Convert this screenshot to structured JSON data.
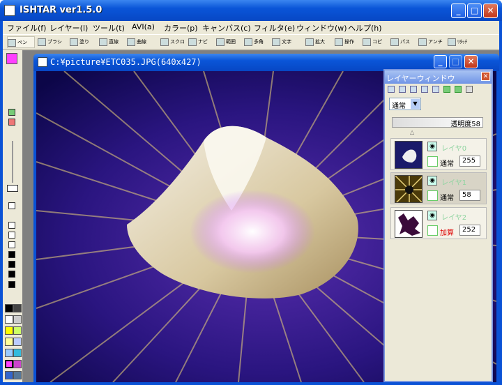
{
  "window": {
    "title": "ISHTAR ver1.5.0"
  },
  "menu": [
    "ファイル(f)",
    "レイヤー(l)",
    "ツール(t)",
    "AVI(a)",
    "カラー(p)",
    "キャンバス(c)",
    "フィルタ(e)",
    "ウィンドウ(w)",
    "ヘルプ(h)"
  ],
  "toolbar": [
    "ペン",
    "ブラシ",
    "塗り",
    "直線",
    "曲線",
    "スクロ",
    "ナビ",
    "範囲",
    "多角",
    "文字",
    "拡大",
    "操作",
    "コピ",
    "パス",
    "アンチ",
    "ﾘﾀｯﾁ"
  ],
  "document": {
    "title": "C:¥picture¥ETC035.JPG(640x427)"
  },
  "layer_window": {
    "title": "レイヤーウィンドウ",
    "blend_mode": "通常",
    "opacity_label": "透明度58",
    "layers": [
      {
        "name": "レイヤ0",
        "mode": "通常",
        "opacity": "255"
      },
      {
        "name": "レイヤ1",
        "mode": "通常",
        "opacity": "58"
      },
      {
        "name": "レイヤ2",
        "mode": "加算",
        "opacity": "252"
      }
    ]
  },
  "colors": {
    "primary": "#ff40ff",
    "accent": "#0a52d6"
  }
}
